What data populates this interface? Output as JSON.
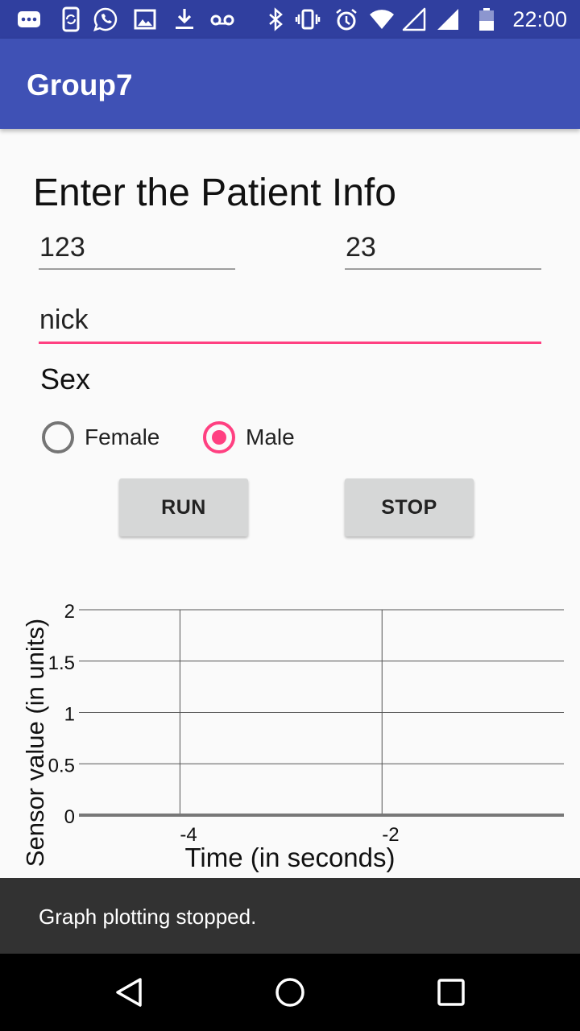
{
  "status_bar": {
    "time": "22:00",
    "left_icons": [
      "more-icon",
      "sync-phone-icon",
      "whatsapp-icon",
      "image-icon",
      "download-icon",
      "voicemail-icon"
    ],
    "right_icons": [
      "bluetooth-icon",
      "vibrate-icon",
      "alarm-icon",
      "wifi-icon",
      "signal-empty-icon",
      "signal-icon",
      "battery-icon"
    ]
  },
  "app_bar": {
    "title": "Group7"
  },
  "form": {
    "heading": "Enter the Patient Info",
    "patient_id": "123",
    "age": "23",
    "name": "nick",
    "sex_label": "Sex",
    "sex_options": [
      {
        "label": "Female",
        "checked": false
      },
      {
        "label": "Male",
        "checked": true
      }
    ],
    "run_label": "RUN",
    "stop_label": "STOP"
  },
  "chart_data": {
    "type": "line",
    "xlabel": "Time (in seconds)",
    "ylabel": "Sensor value (in units)",
    "ylim": [
      0,
      2
    ],
    "y_ticks": [
      0,
      0.5,
      1,
      1.5,
      2
    ],
    "y_tick_labels": [
      "0",
      "0.5",
      "1",
      "1.5",
      "2"
    ],
    "xlim": [
      -5,
      -0.2
    ],
    "x_ticks": [
      -4,
      -2
    ],
    "x_tick_labels": [
      "-4",
      "-2"
    ],
    "series": [],
    "grid": true
  },
  "toast": {
    "message": "Graph plotting stopped."
  },
  "colors": {
    "primary": "#3f51b5",
    "primary_dark": "#303f9f",
    "accent": "#ff4081"
  },
  "nav_bar": {
    "icons": [
      "back-icon",
      "home-icon",
      "recents-icon"
    ]
  }
}
